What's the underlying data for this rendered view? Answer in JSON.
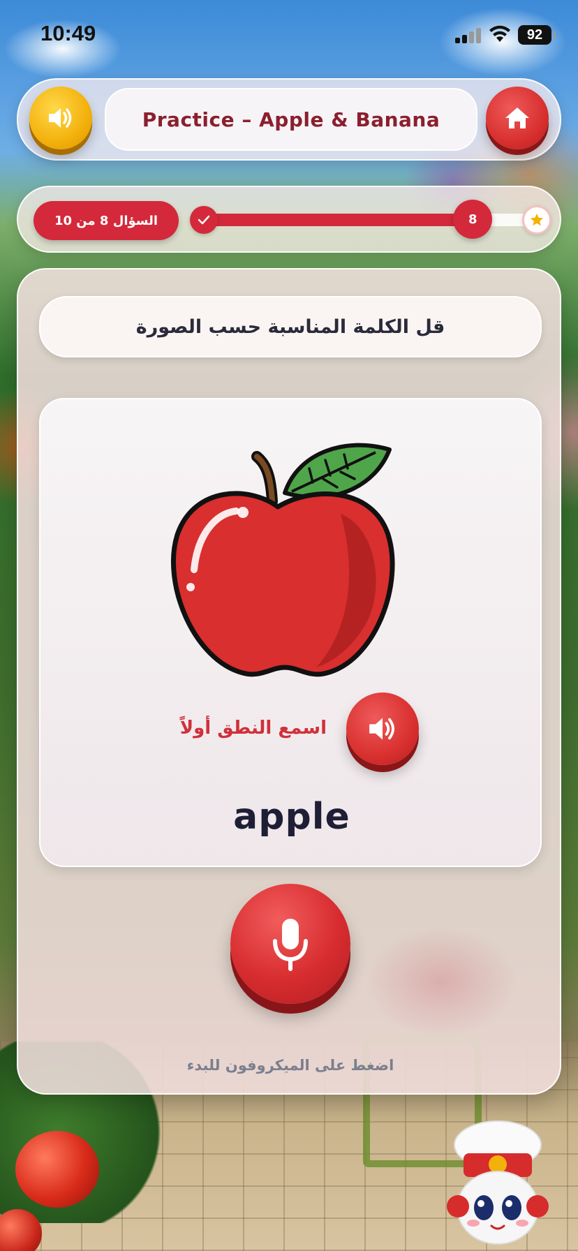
{
  "status_bar": {
    "time": "10:49",
    "battery": "92"
  },
  "header": {
    "title": "Practice – Apple & Banana",
    "sound_icon": "speaker-icon",
    "home_icon": "home-icon"
  },
  "progress": {
    "question_label": "السؤال 8 من 10",
    "current": "8",
    "current_value": 8,
    "total": 10,
    "start_icon": "check-icon",
    "end_icon": "star-icon"
  },
  "card": {
    "instruction": "قل الكلمة المناسبة حسب الصورة",
    "image_icon": "apple-illustration",
    "listen_label": "اسمع النطق أولاً",
    "listen_icon": "speaker-icon",
    "word": "apple",
    "mic_icon": "microphone-icon",
    "mic_hint": "اضغط على الميكروفون للبدء"
  },
  "colors": {
    "accent_red": "#d3293b",
    "accent_yellow": "#f3b10c",
    "title_text": "#8b1f2e",
    "word_text": "#1e1e36"
  }
}
